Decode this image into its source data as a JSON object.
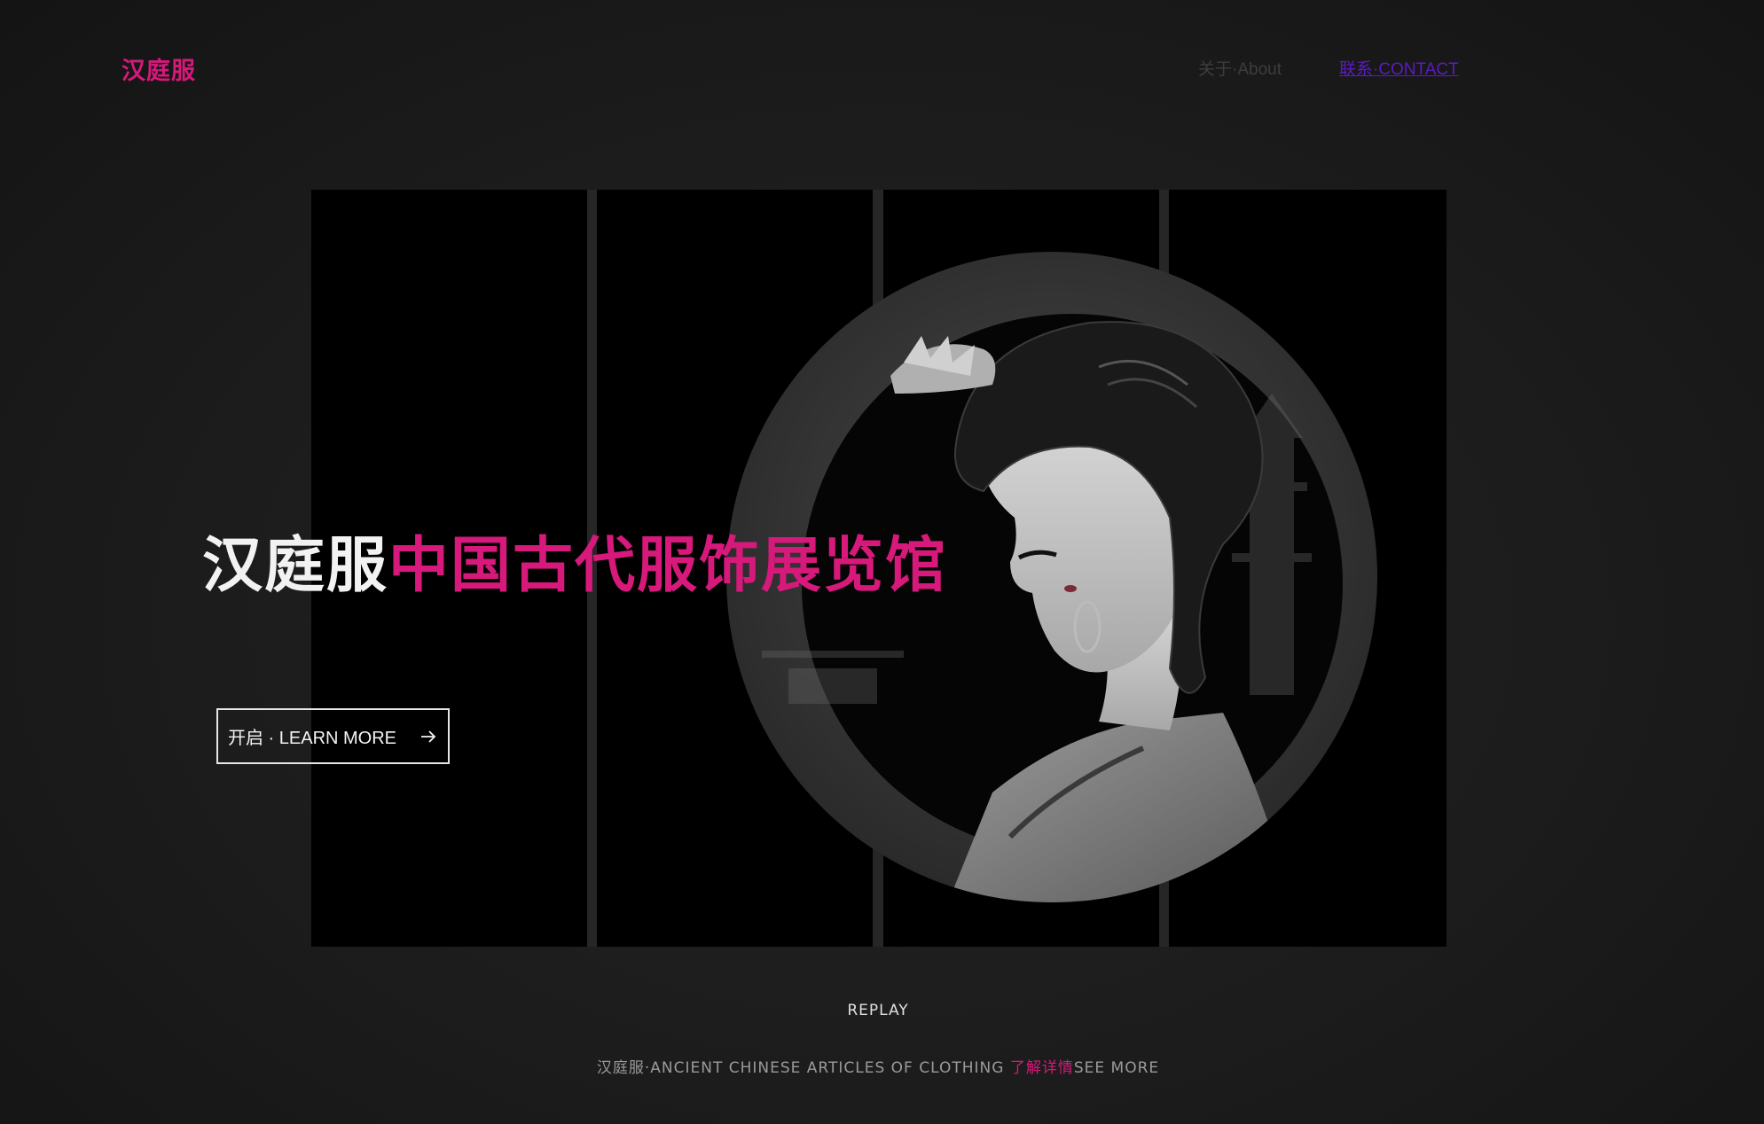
{
  "header": {
    "logo": "汉庭服",
    "nav": [
      {
        "label": "关于·About"
      },
      {
        "label": "联系·CONTACT"
      }
    ]
  },
  "hero": {
    "title_white": "汉庭服",
    "title_pink": "中国古代服饰展览馆",
    "cta_label": "开启 · LEARN MORE",
    "cta_icon": "arrow-right-icon",
    "image": "portrait of a woman in ancient Chinese dress within a circular frame, split across four vertical panels"
  },
  "replay_label": "REPLAY",
  "footer": {
    "caption": "汉庭服·ANCIENT CHINESE ARTICLES OF CLOTHING ",
    "more_link": "了解详情",
    "see_more": "SEE MORE"
  },
  "colors": {
    "accent": "#d6197a",
    "background": "#1c1c1c",
    "panel": "#000000",
    "contact_link": "#5b1cc0"
  }
}
